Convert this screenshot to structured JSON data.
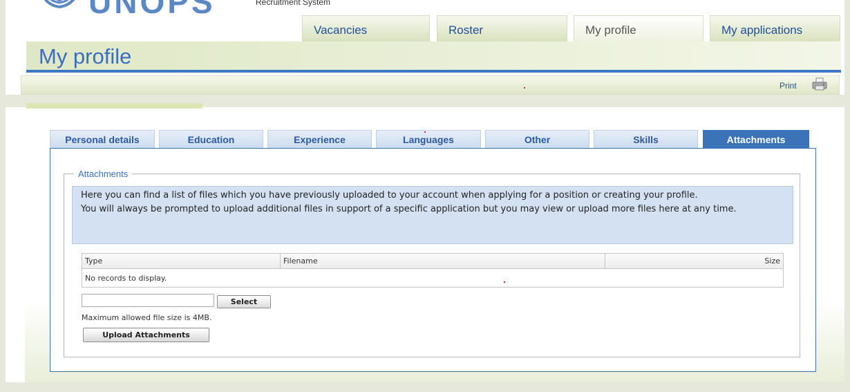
{
  "logo": {
    "sub": "Recruitment System"
  },
  "nav": {
    "tabs": [
      {
        "label": "Vacancies"
      },
      {
        "label": "Roster"
      },
      {
        "label": "My profile",
        "active": true
      },
      {
        "label": "My applications"
      }
    ]
  },
  "header": {
    "title": "My profile",
    "print": "Print"
  },
  "profile_tabs": [
    {
      "label": "Personal details"
    },
    {
      "label": "Education"
    },
    {
      "label": "Experience"
    },
    {
      "label": "Languages"
    },
    {
      "label": "Other"
    },
    {
      "label": "Skills"
    },
    {
      "label": "Attachments",
      "active": true
    }
  ],
  "attachments": {
    "legend": "Attachments",
    "info": [
      "Here you can find a list of files which you have previously uploaded to your account when applying for a position or creating your profile.",
      "You will always be prompted to upload additional files in support of a specific application but you may view or upload more files here at any time."
    ],
    "grid": {
      "columns": [
        "Type",
        "Filename",
        "Size"
      ],
      "empty": "No records to display."
    },
    "file_input": {
      "value": ""
    },
    "select_label": "Select",
    "max_size": "Maximum allowed file size is 4MB.",
    "upload_label": "Upload Attachments"
  },
  "colors": {
    "accent": "#3a78c8",
    "tab_active": "#3b73b9",
    "tab_text": "#2b5aa0",
    "info_bg": "#d3e1f2",
    "header_green": "#dfe8c6"
  }
}
